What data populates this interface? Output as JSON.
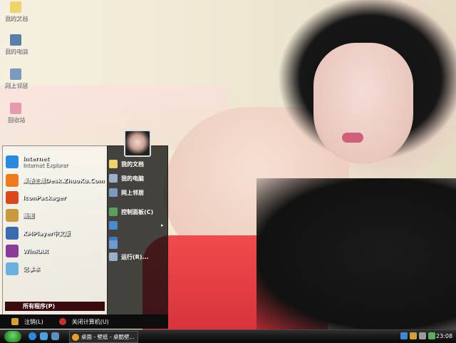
{
  "desktop_icons": [
    {
      "label": "我的文档",
      "icon": "folder-icon",
      "color": "#f2d36b"
    },
    {
      "label": "我的电脑",
      "icon": "computer-icon",
      "color": "#5a7fa8"
    },
    {
      "label": "网上邻居",
      "icon": "network-icon",
      "color": "#7a9ac0"
    },
    {
      "label": "回收站",
      "icon": "recycle-bin-icon",
      "color": "#e69ab0"
    }
  ],
  "start_menu": {
    "programs": [
      {
        "label": "Internet",
        "sub": "Internet Explorer",
        "icon": "internet-explorer-icon",
        "color": "#2a8ae0"
      },
      {
        "label": "桌酷主题Desk.ZhuoKu.Com",
        "icon": "zhuoku-icon",
        "color": "#f07a20"
      },
      {
        "label": "IconPackager",
        "icon": "iconpackager-icon",
        "color": "#d84a1a"
      },
      {
        "label": "画图",
        "icon": "paint-icon",
        "color": "#c89a3a"
      },
      {
        "label": "KMPlayer中文版",
        "icon": "kmplayer-icon",
        "color": "#3a6ab0"
      },
      {
        "label": "WinRAR",
        "icon": "winrar-icon",
        "color": "#8a3a9a"
      },
      {
        "label": "记事本",
        "icon": "notepad-icon",
        "color": "#6ab0e0"
      }
    ],
    "all_programs": "所有程序(P)",
    "right_links": [
      {
        "label": "我的文档",
        "icon": "documents-icon",
        "color": "#f2d36b"
      },
      {
        "label": "我的电脑",
        "icon": "computer-icon",
        "color": "#9ab0c8"
      },
      {
        "label": "网上邻居",
        "icon": "network-icon",
        "color": "#7a9ac0"
      },
      {
        "label": "控制面板(C)",
        "icon": "control-panel-icon",
        "color": "#5aa05a"
      },
      {
        "label": "",
        "icon": "defaults-icon",
        "color": "#4a8ad0"
      },
      {
        "label": "",
        "icon": "help-icon",
        "color": "#3a7ac0"
      },
      {
        "label": "",
        "icon": "search-icon",
        "color": "#6a9ad0"
      },
      {
        "label": "运行(R)...",
        "icon": "run-icon",
        "color": "#9ab0c8"
      }
    ],
    "logoff": "注销(L)",
    "shutdown": "关闭计算机(U)"
  },
  "taskbar": {
    "task_label": "桌面 - 壁纸 - 桌酷壁...",
    "clock": "23:08"
  }
}
